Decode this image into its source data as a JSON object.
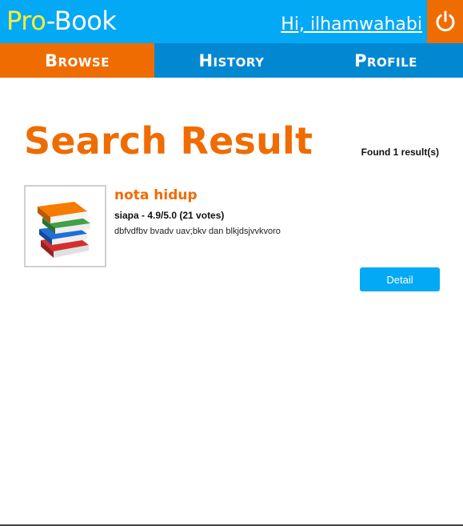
{
  "header": {
    "logo_pro": "Pro",
    "logo_dash": "-",
    "logo_book": "Book",
    "greeting": "Hi, ilhamwahabi",
    "logout_icon": "power-icon",
    "colors": {
      "header_bg": "#03a9f4",
      "logo_accent": "#ffeb3b",
      "logout_bg": "#ef6c00"
    }
  },
  "nav": {
    "tabs": [
      {
        "label": "Browse",
        "active": true
      },
      {
        "label": "History",
        "active": false
      },
      {
        "label": "Profile",
        "active": false
      }
    ],
    "colors": {
      "active": "#ef6c00",
      "inactive": "#0288d1"
    }
  },
  "main": {
    "title": "Search Result",
    "found_text": "Found 1 result(s)",
    "results": [
      {
        "cover_icon": "books-stack-icon",
        "title": "nota hidup",
        "meta": "siapa - 4.9/5.0 (21 votes)",
        "description": "dbfvdfbv bvadv uav;bkv dan blkjdsjvvkvoro",
        "button_label": "Detail"
      }
    ],
    "colors": {
      "accent": "#ef6c00",
      "button": "#03a9f4"
    }
  }
}
